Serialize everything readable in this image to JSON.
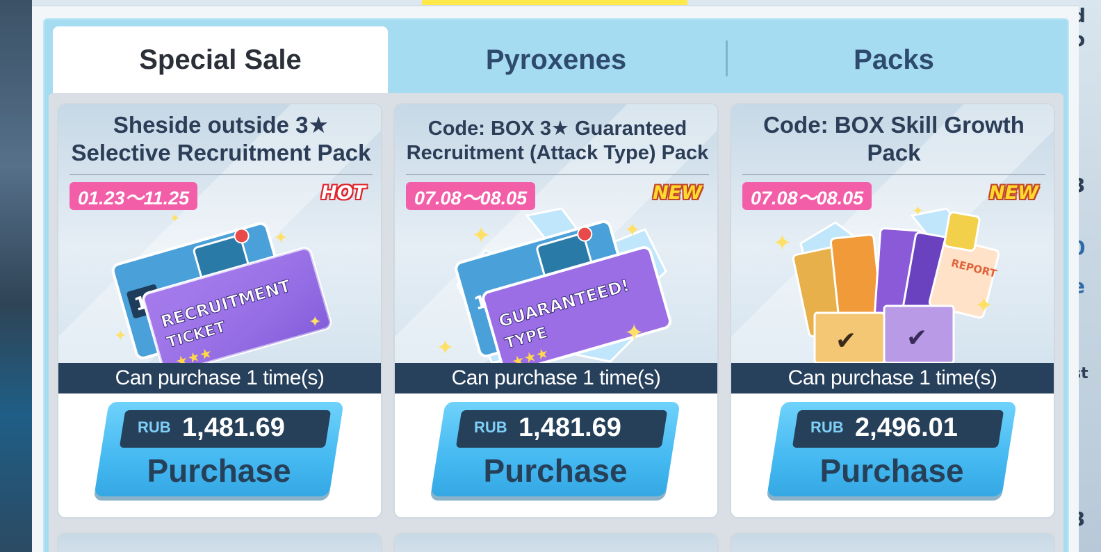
{
  "tabs": [
    {
      "label": "Special Sale",
      "active": true
    },
    {
      "label": "Pyroxenes",
      "active": false
    },
    {
      "label": "Packs",
      "active": false
    }
  ],
  "cards": [
    {
      "title": "Sheside outside 3★ Selective Recruitment Pack",
      "date": "01.23〜11.25",
      "tag": "HOT",
      "art_icon": "recruitment-ticket-icon",
      "art_text": [
        "10",
        "RECRUITMENT",
        "TICKET"
      ],
      "limit": "Can purchase 1 time(s)",
      "currency": "RUB",
      "price": "1,481.69",
      "button": "Purchase"
    },
    {
      "title": "Code: BOX 3★ Guaranteed Recruitment (Attack Type) Pack",
      "date": "07.08〜08.05",
      "tag": "NEW",
      "art_icon": "guaranteed-ticket-icon",
      "art_text": [
        "10",
        "GUARANTEED!",
        "TYPE"
      ],
      "limit": "Can purchase 1 time(s)",
      "currency": "RUB",
      "price": "1,481.69",
      "button": "Purchase"
    },
    {
      "title": "Code: BOX Skill Growth Pack",
      "date": "07.08〜08.05",
      "tag": "NEW",
      "art_icon": "skill-books-icon",
      "art_text": [
        "REPORT"
      ],
      "limit": "Can purchase 1 time(s)",
      "currency": "RUB",
      "price": "2,496.01",
      "button": "Purchase"
    }
  ],
  "colors": {
    "tab_bg": "#a6dcf1",
    "date_badge": "#f25fa8",
    "limit_bar": "#27405c",
    "button": "#45b9f1"
  }
}
